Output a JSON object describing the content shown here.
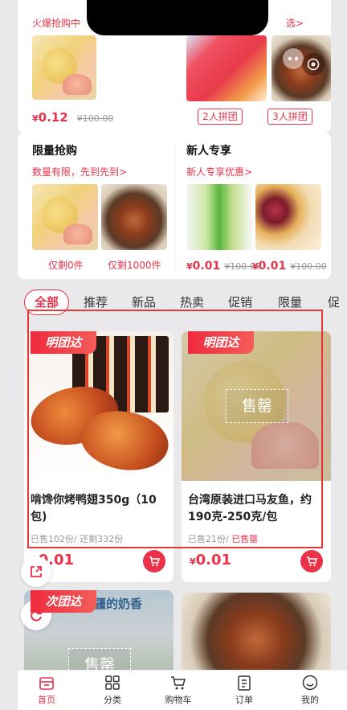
{
  "top_section": {
    "hot_text": "火爆抢购中",
    "select_link": "选>",
    "price_left": "0.12",
    "old_price_left": "¥100.00",
    "group_buttons": [
      "2人拼团",
      "3人拼团"
    ]
  },
  "flash_sale": {
    "title": "限量抢购",
    "subtitle": "数量有限，先到先到>",
    "items": [
      {
        "remaining": "仅剩0件"
      },
      {
        "remaining": "仅剩1000件"
      }
    ]
  },
  "newcomer": {
    "title": "新人专享",
    "subtitle": "新人专享优惠>",
    "items": [
      {
        "price": "0.01",
        "old_price": "¥100.00"
      },
      {
        "price": "0.01",
        "old_price": "¥100.00"
      }
    ]
  },
  "currency": "¥",
  "tabs": [
    "全部",
    "推荐",
    "新品",
    "热卖",
    "促销",
    "限量",
    "促"
  ],
  "products": [
    {
      "badge": "明团达",
      "name": "啃馋你烤鸭翅350g（10包)",
      "sold": "已售102份/ 还剩332份",
      "price": "0.01",
      "sold_out": false
    },
    {
      "badge": "明团达",
      "name": "台湾原装进口马友鱼，约190克-250克/包",
      "sold": "已售21份/",
      "sold_status": "已售罄",
      "price": "0.01",
      "sold_out": true,
      "sold_out_label": "售罄"
    },
    {
      "badge": "次团达",
      "banner_text": "新疆的奶香",
      "sold_out_label": "售罄"
    },
    {}
  ],
  "bottom_nav": [
    {
      "label": "首页",
      "icon": "home-icon",
      "active": true
    },
    {
      "label": "分类",
      "icon": "grid-icon",
      "active": false
    },
    {
      "label": "购物车",
      "icon": "cart-icon",
      "active": false
    },
    {
      "label": "订单",
      "icon": "order-icon",
      "active": false
    },
    {
      "label": "我的",
      "icon": "smile-icon",
      "active": false
    }
  ],
  "colors": {
    "accent": "#e8334a",
    "badge": "#ee2b3f",
    "highlight": "#e53935"
  }
}
